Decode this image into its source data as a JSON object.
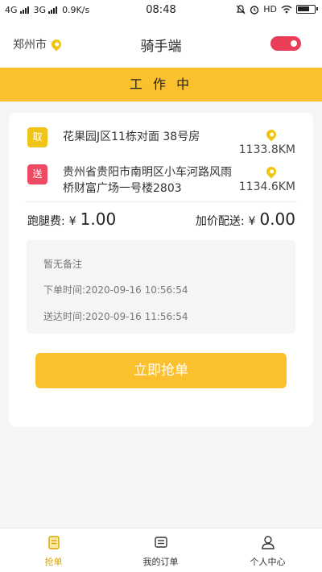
{
  "status_bar": {
    "network1": "4G",
    "network2": "3G",
    "speed": "0.9K/s",
    "time": "08:48",
    "hd": "HD"
  },
  "header": {
    "city": "郑州市",
    "title": "骑手端",
    "toggle_color": "#ea3d57"
  },
  "work_status": "工 作 中",
  "order": {
    "pickup": {
      "tag": "取",
      "address": "花果园J区11栋对面 38号房",
      "distance": "1133.8KM"
    },
    "delivery": {
      "tag": "送",
      "address": "贵州省贵阳市南明区小车河路风雨桥财富广场一号楼2803",
      "distance": "1134.6KM"
    },
    "fee_label": "跑腿费:",
    "fee_currency": "¥",
    "fee_value": "1.00",
    "extra_label": "加价配送:",
    "extra_currency": "¥",
    "extra_value": "0.00",
    "note": "暂无备注",
    "order_time": "下单时间:2020-09-16 10:56:54",
    "delivery_time": "送达时间:2020-09-16 11:56:54",
    "grab_button": "立即抢单"
  },
  "tabs": [
    {
      "label": "抢单",
      "icon": "clipboard-icon",
      "active": true
    },
    {
      "label": "我的订单",
      "icon": "orders-icon",
      "active": false
    },
    {
      "label": "个人中心",
      "icon": "person-icon",
      "active": false
    }
  ],
  "colors": {
    "accent": "#fbc02d",
    "pickup_tag": "#f0c419",
    "delivery_tag": "#ef4a63",
    "active_tab": "#d9a400"
  }
}
